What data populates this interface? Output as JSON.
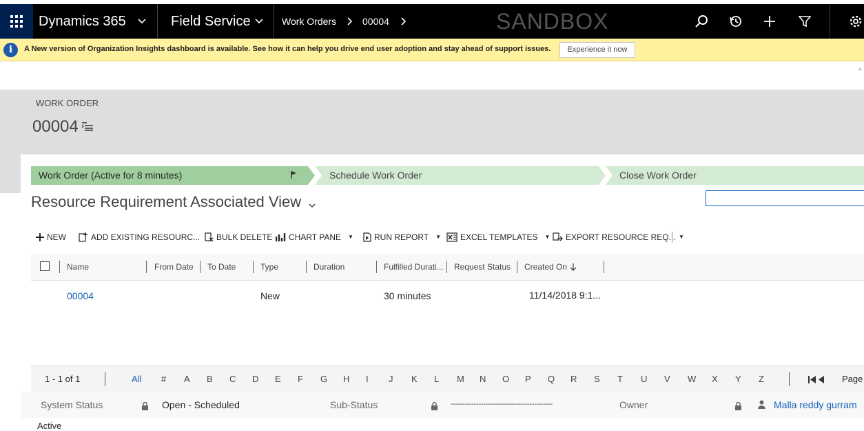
{
  "topnav": {
    "app_name": "Dynamics 365",
    "module": "Field Service",
    "breadcrumb": [
      "Work Orders",
      "00004"
    ],
    "environment_label": "SANDBOX"
  },
  "notification": {
    "message": "A New version of Organization Insights dashboard is available. See how it can help you drive end user adoption and stay ahead of support issues.",
    "button_label": "Experience it now"
  },
  "record": {
    "entity_label": "WORK ORDER",
    "record_name": "00004"
  },
  "process": {
    "stages": [
      {
        "label": "Work Order (Active for 8 minutes)",
        "active": true
      },
      {
        "label": "Schedule Work Order",
        "active": false
      },
      {
        "label": "Close Work Order",
        "active": false
      }
    ]
  },
  "view": {
    "title": "Resource Requirement Associated View"
  },
  "toolbar": {
    "new": "NEW",
    "add_existing": "ADD EXISTING RESOURC...",
    "bulk_delete": "BULK DELETE",
    "chart_pane": "CHART PANE",
    "run_report": "RUN REPORT",
    "excel_templates": "EXCEL TEMPLATES",
    "export": "EXPORT RESOURCE REQ..."
  },
  "grid": {
    "columns": [
      "Name",
      "From Date",
      "To Date",
      "Type",
      "Duration",
      "Fulfilled Durati...",
      "Request Status",
      "Created On"
    ],
    "rows": [
      {
        "name": "00004",
        "from_date": "",
        "to_date": "",
        "type": "New",
        "duration": "",
        "fulfilled_duration": "30 minutes",
        "request_status": "",
        "created_on": "11/14/2018 9:1..."
      }
    ],
    "record_count": "1 - 1 of 1",
    "alpha_filter": [
      "All",
      "#",
      "A",
      "B",
      "C",
      "D",
      "E",
      "F",
      "G",
      "H",
      "I",
      "J",
      "K",
      "L",
      "M",
      "N",
      "O",
      "P",
      "Q",
      "R",
      "S",
      "T",
      "U",
      "V",
      "W",
      "X",
      "Y",
      "Z"
    ],
    "page_label": "Page"
  },
  "footer": {
    "system_status_label": "System Status",
    "system_status_value": "Open - Scheduled",
    "sub_status_label": "Sub-Status",
    "sub_status_value": "--------------------------------------------",
    "owner_label": "Owner",
    "owner_value": "Malla reddy gurram",
    "status_value": "Active"
  },
  "colors": {
    "nav_bg": "#000000",
    "waffle_bg": "#002050",
    "notif_bg": "#fff19d",
    "active_stage": "#9fcf9e",
    "inactive_stage": "#d3ebd3",
    "link": "#1160b7"
  }
}
